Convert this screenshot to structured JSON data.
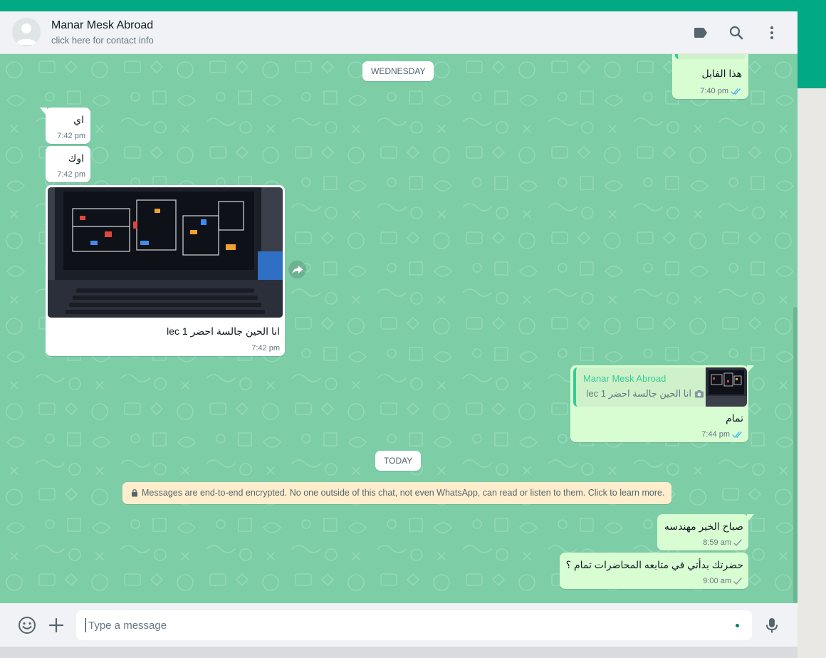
{
  "header": {
    "name": "Manar Mesk Abroad",
    "subtitle": "click here for contact info",
    "icons": [
      "label-icon",
      "search-icon",
      "menu-icon"
    ]
  },
  "dates": {
    "wednesday": "WEDNESDAY",
    "today": "TODAY"
  },
  "messages": [
    {
      "dir": "out",
      "text": "هذا الفايل",
      "time": "7:40 pm",
      "status": "read"
    },
    {
      "dir": "in",
      "text": "اي",
      "time": "7:42 pm"
    },
    {
      "dir": "in",
      "text": "اوك",
      "time": "7:42 pm"
    },
    {
      "dir": "in",
      "type": "photo",
      "caption": "انا الحين جالسة احضر lec 1",
      "time": "7:42 pm"
    },
    {
      "dir": "out",
      "type": "reply",
      "quote_author": "Manar Mesk Abroad",
      "quote_text": "انا الحين جالسة احضر lec 1",
      "text": "تمام",
      "time": "7:44 pm",
      "status": "read"
    },
    {
      "dir": "out",
      "text": "صباح الخير مهندسه",
      "time": "8:59 am",
      "status": "sent"
    },
    {
      "dir": "out",
      "text": "حضرتك بدأتي في متابعه المحاضرات تمام ؟",
      "time": "9:00 am",
      "status": "sent"
    }
  ],
  "system": {
    "encryption": "Messages are end-to-end encrypted. No one outside of this chat, not even WhatsApp, can read or listen to them. Click to learn more."
  },
  "composer": {
    "placeholder": "Type a message",
    "icons": [
      "emoji-icon",
      "attach-icon",
      "mic-icon"
    ]
  },
  "colors": {
    "brand": "#00a884",
    "chat_bg": "#7dcda7",
    "outgoing": "#d9fdd3",
    "incoming": "#ffffff",
    "read_tick": "#53bdeb",
    "system_note": "#ffeecd"
  }
}
